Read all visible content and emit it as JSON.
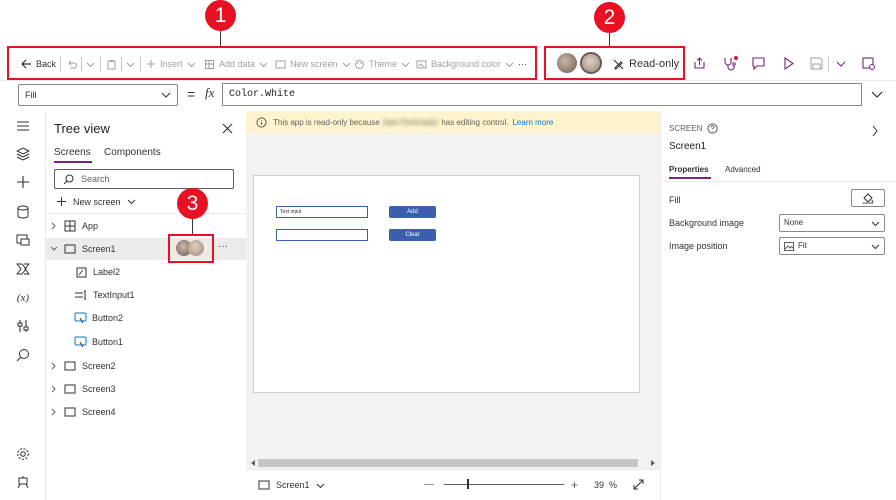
{
  "callouts": [
    "1",
    "2",
    "3"
  ],
  "toolbar": {
    "back": "Back",
    "insert": "Insert",
    "add_data": "Add data",
    "new_screen": "New screen",
    "theme": "Theme",
    "background_color": "Background color",
    "more": "···",
    "read_only": "Read-only"
  },
  "formula": {
    "property": "Fill",
    "equals": "=",
    "fx": "fx",
    "expression": "Color.White"
  },
  "tree": {
    "title": "Tree view",
    "tabs": [
      "Screens",
      "Components"
    ],
    "search_placeholder": "Search",
    "new_screen": "New screen",
    "items": [
      "App",
      "Screen1",
      "Label2",
      "TextInput1",
      "Button2",
      "Button1",
      "Screen2",
      "Screen3",
      "Screen4"
    ],
    "more": "···"
  },
  "canvas": {
    "banner_prefix": "This app is read-only because",
    "banner_user": "Sam Perlmutter",
    "banner_suffix": "has editing control.",
    "learn_more": "Learn more",
    "text_input": "Text input",
    "add_label": "Add",
    "clear_label": "Clear",
    "screen_name": "Screen1",
    "zoom_minus": "—",
    "zoom_plus": "+",
    "zoom_value": "39",
    "zoom_unit": "%"
  },
  "props": {
    "section": "SCREEN",
    "name": "Screen1",
    "tabs": [
      "Properties",
      "Advanced"
    ],
    "fill_label": "Fill",
    "bg_image_label": "Background image",
    "bg_image_value": "None",
    "img_pos_label": "Image position",
    "img_pos_value": "Fit"
  },
  "colors": {
    "accent": "#742774",
    "callout": "#e81123",
    "button": "#3b5fad",
    "banner": "#fff4ce"
  }
}
